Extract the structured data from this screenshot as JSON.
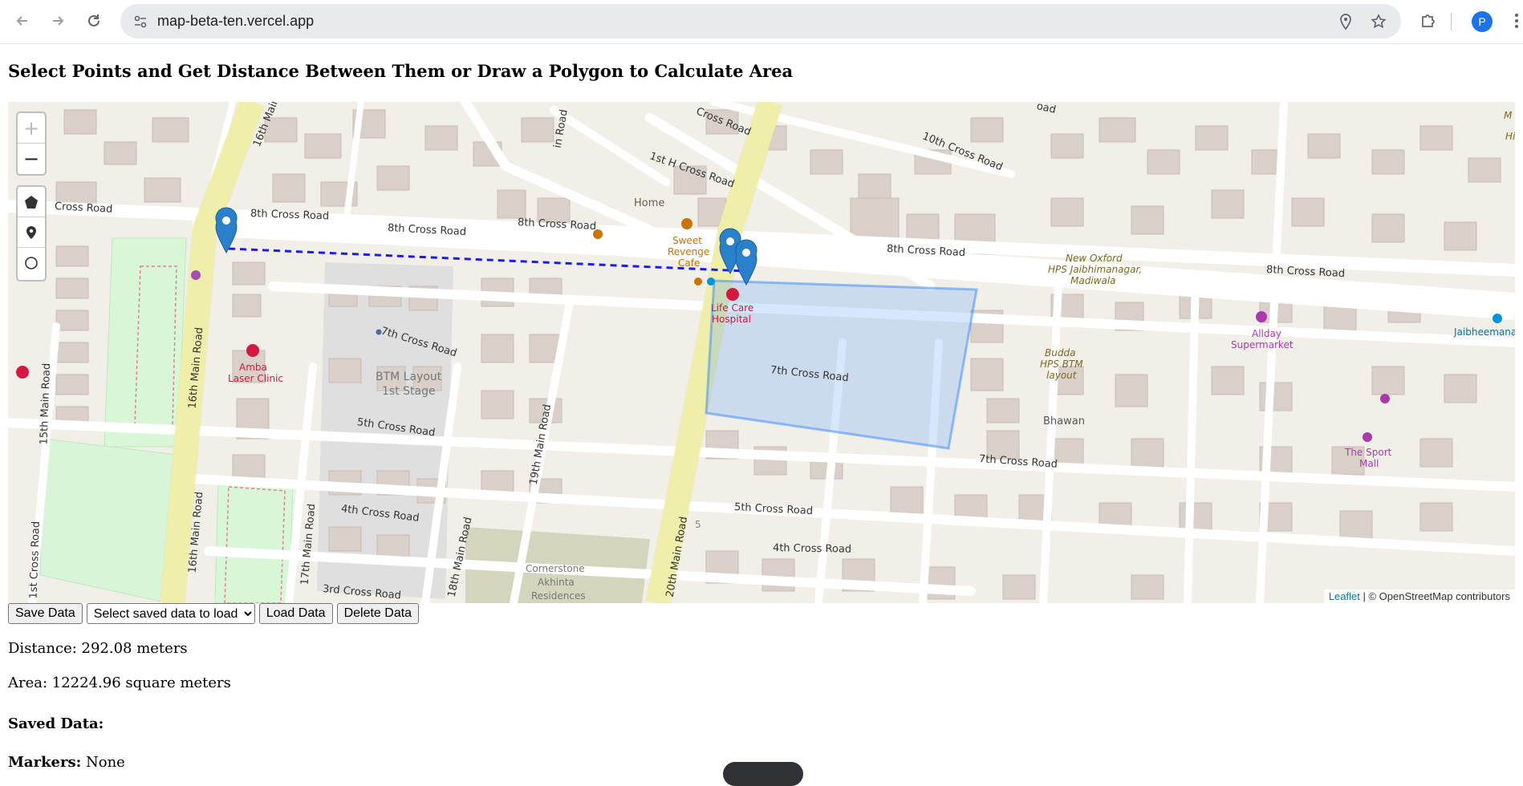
{
  "browser": {
    "url": "map-beta-ten.vercel.app",
    "profile_initial": "P"
  },
  "page": {
    "title": "Select Points and Get Distance Between Them or Draw a Polygon to Calculate Area"
  },
  "map": {
    "zoom_in": "+",
    "zoom_out": "−",
    "attribution_link": "Leaflet",
    "attribution_text": "| © OpenStreetMap contributors",
    "street_labels": {
      "cross8_a": "8th Cross Road",
      "cross8_b": "8th Cross Road",
      "cross8_c": "8th Cross Road",
      "cross8_d": "8th Cross Road",
      "cross8_e": "8th Cross Road",
      "cross8_left": "Cross Road",
      "cross7_a": "7th Cross Road",
      "cross7_b": "7th Cross Road",
      "cross7_c": "7th Cross Road",
      "cross5_a": "5th Cross Road",
      "cross5_b": "5th Cross Road",
      "cross4_a": "4th Cross Road",
      "cross4_b": "4th Cross Road",
      "cross3": "3rd Cross Road",
      "cross10": "10th Cross Road",
      "cross1h": "1st H Cross Road",
      "cross_top": "Cross Road",
      "main16_a": "16th Main Road",
      "main16_b": "16th Main Road",
      "main16_c": "16th Main",
      "main15": "15th Main Road",
      "main17": "17th Main Road",
      "main18": "18th Main Road",
      "main19": "19th Main Road",
      "main20": "20th Main Road",
      "cross1st": "1st Cross Road",
      "main_top": "in Road",
      "road_top_right": "oad"
    },
    "places": {
      "home": "Home",
      "sweet_revenge_1": "Sweet",
      "sweet_revenge_2": "Revenge",
      "sweet_revenge_3": "Cafe",
      "life_care_1": "Life Care",
      "life_care_2": "Hospital",
      "amba_1": "Amba",
      "amba_2": "Laser Clinic",
      "btm_1": "BTM Layout",
      "btm_2": "1st Stage",
      "new_oxford_1": "New Oxford",
      "new_oxford_2": "HPS Jaibhimanagar,",
      "new_oxford_3": "Madiwala",
      "budda_1": "Budda",
      "budda_2": "HPS BTM",
      "budda_3": "layout",
      "bhawan": "Bhawan",
      "allday_1": "Allday",
      "allday_2": "Supermarket",
      "jaibheema": "Jaibheemana",
      "sport_mall_1": "The Sport",
      "sport_mall_2": "Mall",
      "cornerstone_1": "Cornerstone",
      "cornerstone_2": "Akhinta",
      "cornerstone_3": "Residences",
      "num5": "5",
      "edge_m": "M",
      "edge_h": "Hi"
    }
  },
  "controls": {
    "save_label": "Save Data",
    "select_placeholder": "Select saved data to load",
    "load_label": "Load Data",
    "delete_label": "Delete Data"
  },
  "results": {
    "distance_text": "Distance: 292.08 meters",
    "area_text": "Area: 12224.96 square meters",
    "saved_heading": "Saved Data:",
    "markers_label": "Markers:",
    "markers_value": "None"
  }
}
